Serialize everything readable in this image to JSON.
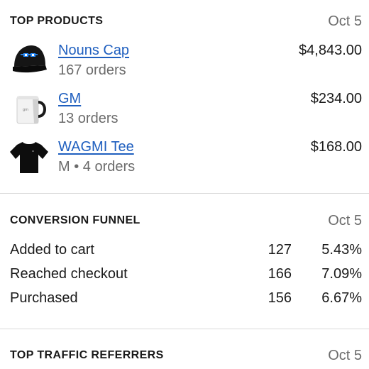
{
  "top_products": {
    "title": "TOP PRODUCTS",
    "date": "Oct 5",
    "items": [
      {
        "name": "Nouns Cap",
        "subtitle": "167 orders",
        "price": "$4,843.00",
        "icon": "cap-thumbnail"
      },
      {
        "name": "GM",
        "subtitle": "13 orders",
        "price": "$234.00",
        "icon": "mug-thumbnail"
      },
      {
        "name": "WAGMI Tee",
        "subtitle": "M • 4 orders",
        "price": "$168.00",
        "icon": "tshirt-thumbnail"
      }
    ]
  },
  "conversion_funnel": {
    "title": "CONVERSION FUNNEL",
    "date": "Oct 5",
    "rows": [
      {
        "label": "Added to cart",
        "count": "127",
        "percent": "5.43%"
      },
      {
        "label": "Reached checkout",
        "count": "166",
        "percent": "7.09%"
      },
      {
        "label": "Purchased",
        "count": "156",
        "percent": "6.67%"
      }
    ]
  },
  "top_traffic_referrers": {
    "title": "TOP TRAFFIC REFERRERS",
    "date": "Oct 5"
  },
  "colors": {
    "link": "#1f5fbf",
    "muted": "#6b6b6b",
    "divider": "#d9d9d9"
  }
}
